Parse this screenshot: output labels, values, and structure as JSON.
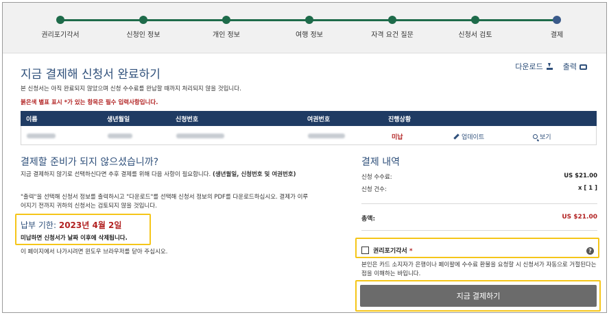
{
  "progress": {
    "steps": [
      {
        "label": "권리포기각서",
        "state": "done"
      },
      {
        "label": "신청인 정보",
        "state": "done"
      },
      {
        "label": "개인 정보",
        "state": "done"
      },
      {
        "label": "여행 정보",
        "state": "done"
      },
      {
        "label": "자격 요건 질문",
        "state": "done"
      },
      {
        "label": "신청서 검토",
        "state": "done"
      },
      {
        "label": "결제",
        "state": "current"
      }
    ]
  },
  "header": {
    "title": "지금 결제해 신청서 완료하기",
    "download_label": "다운로드",
    "print_label": "출력",
    "notice": "본 신청서는 아직 완료되지 않았으며 신청 수수료를 완납할 때까지 처리되지 않을 것입니다.",
    "required_note": "붉은색 별표 표시 *가 있는 항목은 필수 입력사항입니다."
  },
  "table": {
    "columns": [
      "이름",
      "생년월일",
      "신청번호",
      "여권번호",
      "진행상황"
    ],
    "row": {
      "status": "미납",
      "update_label": "업데이트",
      "view_label": "보기"
    }
  },
  "left": {
    "title": "결제할 준비가 되지 않으셨습니까?",
    "para1_text": "지금 결제하지 않기로 선택하신다면 추후 결제를 위해 다음 사항이 필요합니다. ",
    "para1_bold": "(생년월일, 신청번호 및 여권번호)",
    "para2": "\"출력\"을 선택해 신청서 정보를 출력하시고 \"다운로드\"를 선택해 신청서 정보의 PDF를 다운로드하십시오. 결제가 이루어지기 전까지 귀하의 신청서는 검토되지 않을 것입니다.",
    "due_label": "납부 기한:",
    "due_date": "2023년 4월 2일",
    "due_note": "미납하면 신청서가 날짜 이후에 삭제됩니다.",
    "close_note": "이 페이지에서 나가시려면 윈도우 브라우저를 닫아 주십시오."
  },
  "payment": {
    "title": "결제 내역",
    "fee_label": "신청 수수료:",
    "fee_value": "US $21.00",
    "count_label": "신청 건수:",
    "count_value": "x [ 1 ]",
    "total_label": "총액:",
    "total_value": "US $21.00",
    "waiver_label": "권리포기각서",
    "waiver_required": "*",
    "waiver_help": "?",
    "waiver_desc": "본인은 카드 소지자가 은행이나 페이팔에 수수료 환불을 요청할 시 신청서가 자동으로 거절된다는 점을 이해하는 바입니다.",
    "pay_button": "지금 결제하기"
  },
  "colors": {
    "accent": "#2e4f7a",
    "header_bg": "#1f3b63",
    "progress_done": "#1e6b4a",
    "required_red": "#b22222",
    "highlight": "#f5c518",
    "button_gray": "#6b6b6b"
  }
}
